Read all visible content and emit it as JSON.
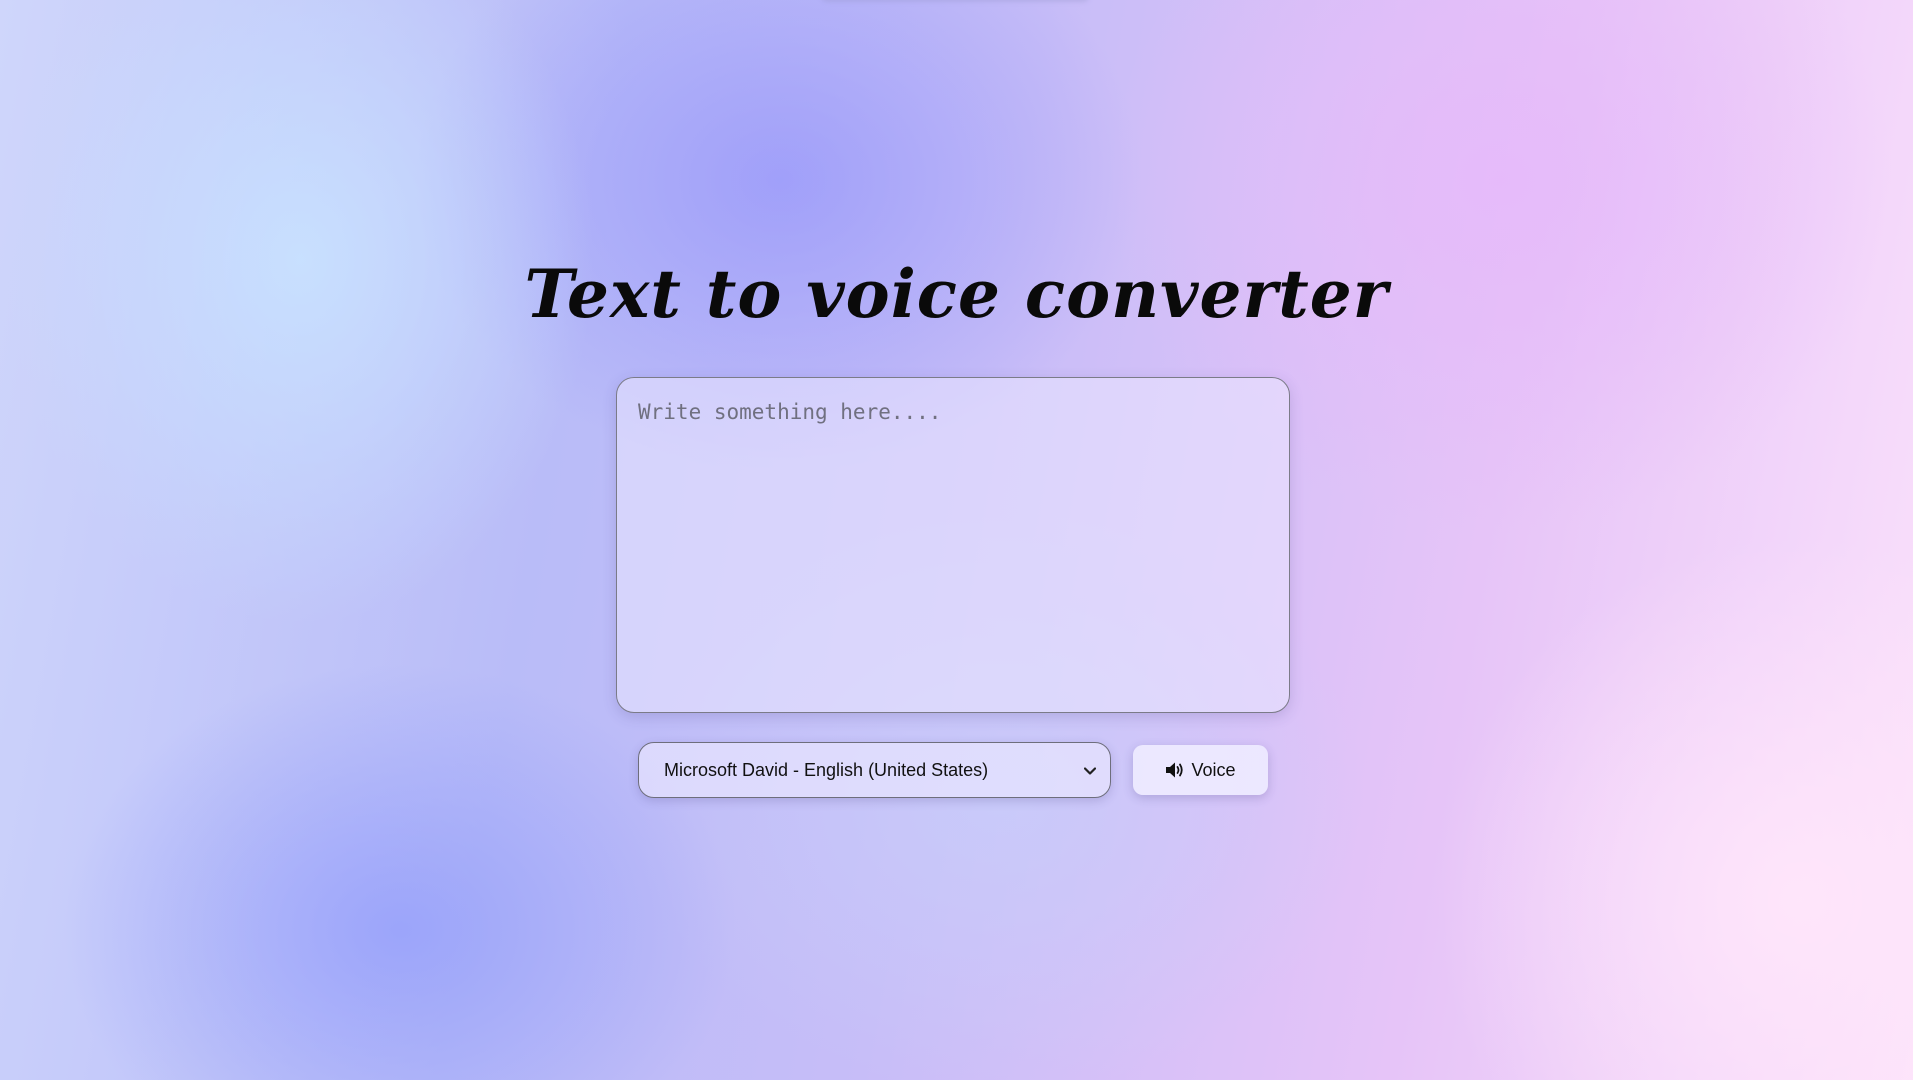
{
  "page": {
    "title": "Text to voice converter"
  },
  "editor": {
    "placeholder": "Write something here....",
    "value": ""
  },
  "voice_select": {
    "selected": "Microsoft David - English (United States)",
    "chevron_icon": "chevron-down-icon"
  },
  "voice_button": {
    "label": "Voice",
    "icon": "speaker-icon"
  }
}
